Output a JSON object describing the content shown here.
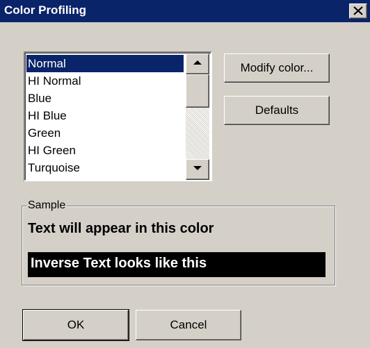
{
  "window": {
    "title": "Color Profiling",
    "colors": {
      "titlebar": "#0a246a",
      "face": "#d4d0c8"
    }
  },
  "color_list": {
    "items": [
      "Normal",
      "HI Normal",
      "Blue",
      "HI Blue",
      "Green",
      "HI Green",
      "Turquoise"
    ],
    "selected": "Normal"
  },
  "buttons": {
    "modify": "Modify color...",
    "defaults": "Defaults",
    "ok": "OK",
    "cancel": "Cancel"
  },
  "sample": {
    "label": "Sample",
    "text": "Text will appear in this color",
    "inverse_text": "Inverse Text looks like this"
  },
  "icons": {
    "close": "close-icon",
    "scroll_up": "arrow-up-icon",
    "scroll_down": "arrow-down-icon"
  }
}
